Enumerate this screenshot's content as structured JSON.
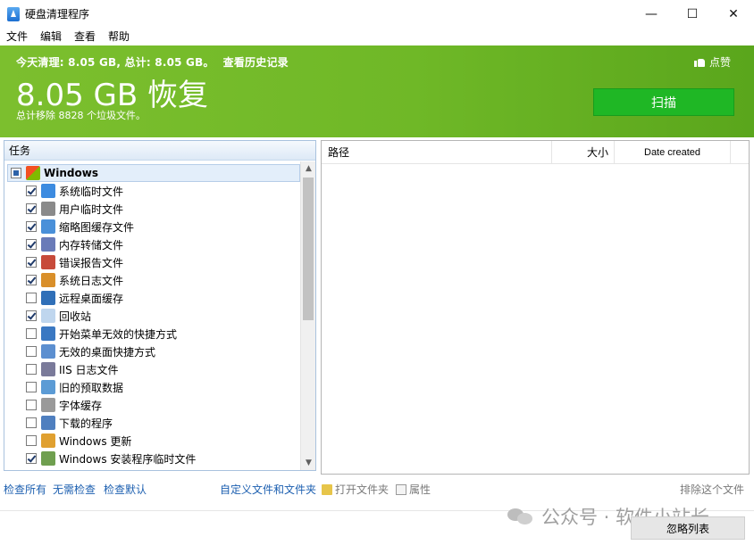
{
  "window": {
    "title": "硬盘清理程序",
    "minimize": "—",
    "maximize": "☐",
    "close": "✕"
  },
  "menu": [
    "文件",
    "编辑",
    "查看",
    "帮助"
  ],
  "banner": {
    "summary": "今天清理: 8.05 GB, 总计: 8.05 GB。",
    "history_link": "查看历史记录",
    "big_text": "8.05 GB 恢复",
    "sub_text": "总计移除 8828 个垃圾文件。",
    "like_label": "点赞",
    "scan_button": "扫描",
    "colors": {
      "banner": "#74bb2a",
      "scan": "#1fb725"
    }
  },
  "left": {
    "header": "任务",
    "group": {
      "label": "Windows",
      "state": "partial"
    },
    "items": [
      {
        "label": "系统临时文件",
        "checked": true,
        "icon": "windows-temp-icon"
      },
      {
        "label": "用户临时文件",
        "checked": true,
        "icon": "user-temp-icon"
      },
      {
        "label": "缩略图缓存文件",
        "checked": true,
        "icon": "thumbnail-icon"
      },
      {
        "label": "内存转储文件",
        "checked": true,
        "icon": "memory-dump-icon"
      },
      {
        "label": "错误报告文件",
        "checked": true,
        "icon": "error-report-icon"
      },
      {
        "label": "系统日志文件",
        "checked": true,
        "icon": "system-log-icon"
      },
      {
        "label": "远程桌面缓存",
        "checked": false,
        "icon": "remote-desktop-icon"
      },
      {
        "label": "回收站",
        "checked": true,
        "icon": "recycle-bin-icon"
      },
      {
        "label": "开始菜单无效的快捷方式",
        "checked": false,
        "icon": "start-menu-icon"
      },
      {
        "label": "无效的桌面快捷方式",
        "checked": false,
        "icon": "desktop-shortcut-icon"
      },
      {
        "label": "IIS 日志文件",
        "checked": false,
        "icon": "iis-log-icon"
      },
      {
        "label": "旧的预取数据",
        "checked": false,
        "icon": "prefetch-icon"
      },
      {
        "label": "字体缓存",
        "checked": false,
        "icon": "font-cache-icon"
      },
      {
        "label": "下载的程序",
        "checked": false,
        "icon": "downloaded-programs-icon"
      },
      {
        "label": "Windows 更新",
        "checked": false,
        "icon": "windows-update-icon"
      },
      {
        "label": "Windows 安装程序临时文件",
        "checked": true,
        "icon": "installer-temp-icon"
      }
    ]
  },
  "right": {
    "columns": {
      "path": "路径",
      "size": "大小",
      "date": "Date created"
    }
  },
  "links": {
    "check_all": "检查所有",
    "check_none": "无需检查",
    "check_default": "检查默认",
    "custom": "自定义文件和文件夹",
    "open_folder": "打开文件夹",
    "properties": "属性",
    "exclude": "排除这个文件"
  },
  "footer": {
    "watermark": "公众号 · 软件小站长",
    "ignore_button": "忽略列表"
  }
}
